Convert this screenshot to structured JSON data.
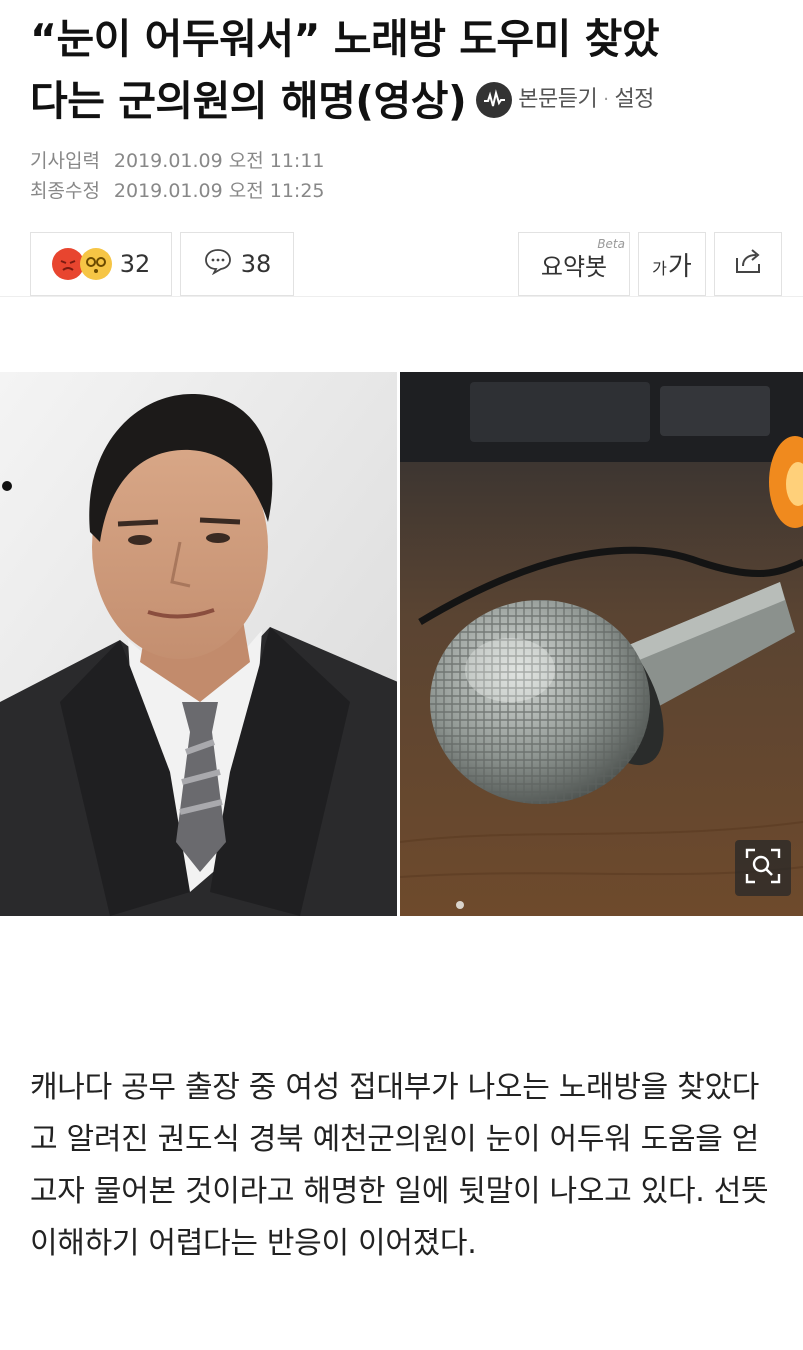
{
  "article": {
    "headline_line1": "“눈이 어두워서” 노래방 도우미 찾았",
    "headline_line2": "다는 군의원의 해명(영상)",
    "listen_label": "본문듣기",
    "settings_label": "설정",
    "meta": {
      "published_label": "기사입력",
      "published_value": "2019.01.09 오전 11:11",
      "modified_label": "최종수정",
      "modified_value": "2019.01.09 오전 11:25"
    },
    "toolbar": {
      "reaction_count": "32",
      "comment_count": "38",
      "summary_label": "요약봇",
      "summary_badge": "Beta",
      "font_small": "가",
      "font_large": "가"
    },
    "body": "캐나다 공무 출장 중 여성 접대부가 나오는 노래방을 찾았다고 알려진 권도식 경북 예천군의원이 눈이 어두워 도움을 얻고자 물어본 것이라고 해명한 일에 뒷말이 나오고 있다. 선뜻 이해하기 어렵다는 반응이 이어졌다."
  },
  "colors": {
    "text": "#111111",
    "meta": "#888888",
    "border": "#e2e2e2",
    "angry": "#e8452f",
    "shock": "#f6c545"
  },
  "icons": [
    "audio-icon",
    "angry-emoji-icon",
    "shock-emoji-icon",
    "comment-icon",
    "share-icon",
    "zoom-icon"
  ]
}
